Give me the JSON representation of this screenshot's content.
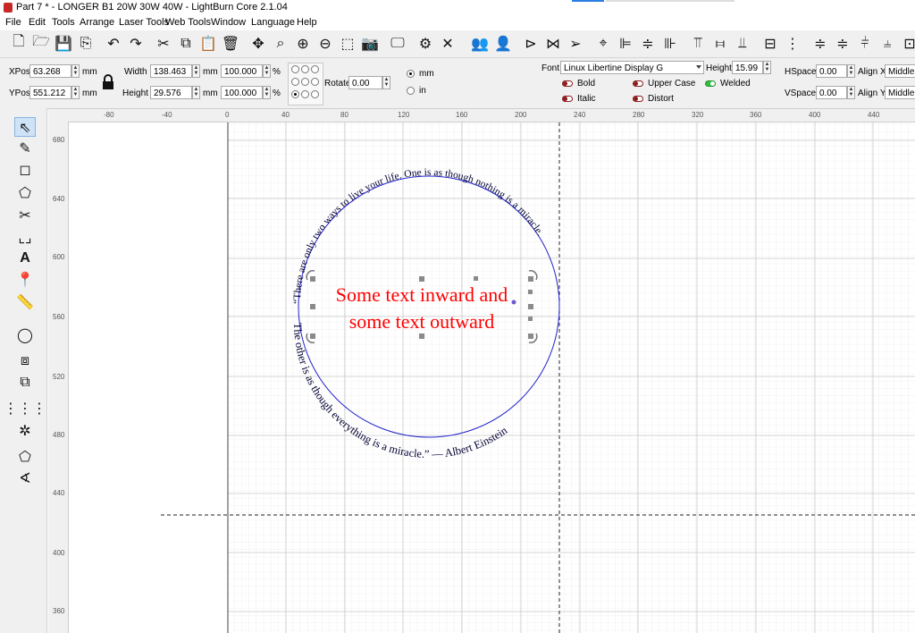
{
  "window": {
    "title": "Part 7 * - LONGER B1 20W 30W 40W - LightBurn Core 2.1.04"
  },
  "menu": [
    "File",
    "Edit",
    "Tools",
    "Arrange",
    "Laser Tools",
    "Web Tools",
    "Window",
    "Language",
    "Help"
  ],
  "toolbar_icons": [
    "new-file-icon",
    "open-folder-icon",
    "save-icon",
    "export-icon",
    "undo-icon",
    "redo-icon",
    "clipboard-cut-icon",
    "copy-icon",
    "paste-icon",
    "delete-icon",
    "move-icon",
    "zoom-fit-icon",
    "zoom-in-icon",
    "zoom-out-icon",
    "select-frame-icon",
    "camera-icon",
    "monitor-icon",
    "settings-icon",
    "tools-icon",
    "group-icon",
    "user-icon",
    "flip-horizontal-icon",
    "mirror-icon",
    "send-icon",
    "target-icon",
    "align-left-icon",
    "align-center-icon",
    "align-right-icon",
    "align-top-icon",
    "align-middle-icon",
    "align-bottom-icon",
    "distribute-icon",
    "distribute-vertical-icon",
    "dock-icon",
    "dock2-icon",
    "dock3-icon",
    "dock4-icon",
    "more-icon"
  ],
  "props": {
    "xpos_label": "XPos",
    "xpos": "63.268",
    "ypos_label": "YPos",
    "ypos": "551.212",
    "unit_mm": "mm",
    "width_label": "Width",
    "width": "138.463",
    "height_label": "Height",
    "height": "29.576",
    "pct1": "100.000",
    "pct2": "100.000",
    "pct_sign": "%",
    "rotate_label": "Rotate",
    "rotate": "0.00",
    "radio_mm": "mm",
    "radio_in": "in",
    "font_label": "Font",
    "font_value": "Linux Libertine Display G",
    "text_height_label": "Height",
    "text_height": "15.99",
    "bold": "Bold",
    "italic": "Italic",
    "upper_case": "Upper Case",
    "distort": "Distort",
    "welded": "Welded",
    "hspace_label": "HSpace",
    "hspace": "0.00",
    "vspace_label": "VSpace",
    "vspace": "0.00",
    "alignx_label": "Align X",
    "alignx": "Middle",
    "aligny_label": "Align Y",
    "aligny": "Middle"
  },
  "left_tools": [
    "select-arrow-icon",
    "pen-icon",
    "rectangle-icon",
    "polygon-icon",
    "scissors-icon",
    "frame-corners-icon",
    "text-tool-icon",
    "position-pin-icon",
    "measure-ruler-icon",
    "offset-ring-icon",
    "weld-icon",
    "boolean-icon",
    "grid-array-icon",
    "circular-array-icon",
    "node-edit-icon",
    "angle-icon"
  ],
  "rulers": {
    "top_labels": [
      "-80",
      "-40",
      "0",
      "40",
      "80",
      "120",
      "160",
      "200",
      "240",
      "280",
      "320",
      "360",
      "400",
      "440"
    ],
    "left_labels": [
      "680",
      "640",
      "600",
      "560",
      "520",
      "480",
      "440",
      "400",
      "360"
    ]
  },
  "canvas": {
    "upper_arc_text": "“There are only two ways to live your life. One is as though nothing is a miracle.",
    "lower_arc_text": "The other is as though everything is a miracle.” — Albert Einstein",
    "center_line1": "Some text inward and",
    "center_line2": "some text outward",
    "colors": {
      "arc_text": "#000033",
      "center_text": "#ff0000",
      "circle": "#2222cc",
      "grid": "#e3e3e3",
      "grid_major": "#c8c8c8",
      "selection_handle": "#8a8a8a"
    }
  }
}
